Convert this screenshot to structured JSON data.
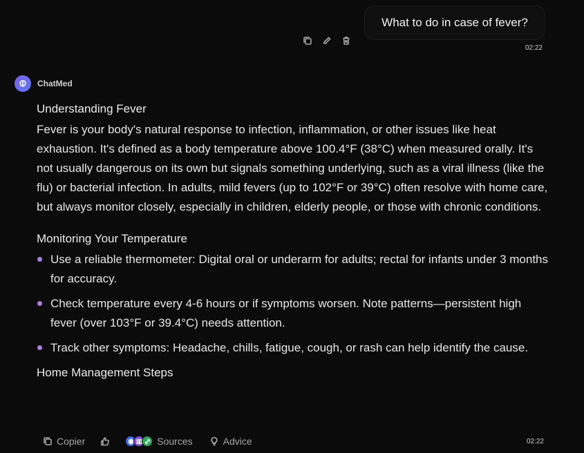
{
  "user_message": {
    "text": "What to do in case of fever?",
    "time": "02:22",
    "actions": [
      "copy-icon",
      "pencil-icon",
      "trash-icon"
    ]
  },
  "assistant": {
    "name": "ChatMed",
    "avatar_icon": "brain-icon",
    "heading_1": "Understanding Fever",
    "paragraph_1": "Fever is your body's natural response to infection, inflammation, or other issues like heat exhaustion. It's defined as a body temperature above 100.4°F (38°C) when measured orally. It's not usually dangerous on its own but signals something underlying, such as a viral illness (like the flu) or bacterial infection. In adults, mild fevers (up to 102°F or 39°C) often resolve with home care, but always monitor closely, especially in children, elderly people, or those with chronic conditions.",
    "heading_2": "Monitoring Your Temperature",
    "bullets": [
      "Use a reliable thermometer: Digital oral or underarm for adults; rectal for infants under 3 months for accuracy.",
      "Check temperature every 4-6 hours or if symptoms worsen. Note patterns—persistent high fever (over 103°F or 39.4°C) needs attention.",
      "Track other symptoms: Headache, chills, fatigue, cough, or rash can help identify the cause."
    ],
    "heading_3": "Home Management Steps"
  },
  "footer": {
    "copy_label": "Copier",
    "sources_label": "Sources",
    "advice_label": "Advice",
    "time": "02:22",
    "bullet_color": "#a782e0",
    "accent_color": "#7c5cf0"
  }
}
